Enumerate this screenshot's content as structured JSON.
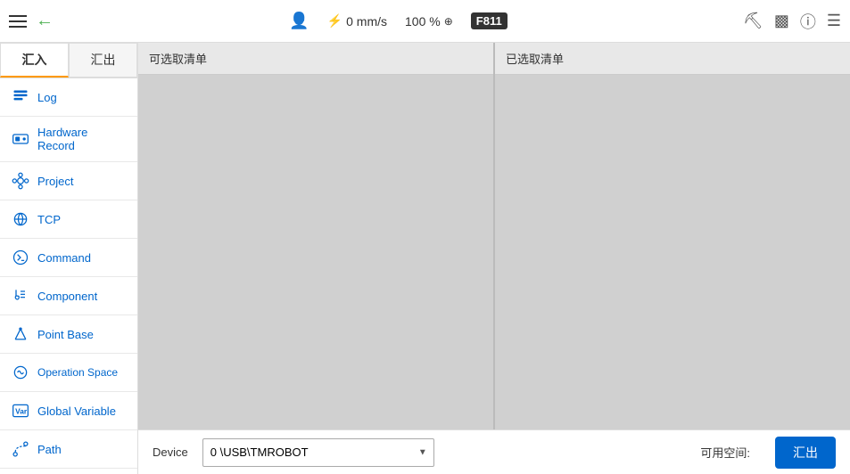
{
  "topbar": {
    "speed": "0 mm/s",
    "percent": "100 %",
    "f811": "F811",
    "icons": [
      "robot-icon",
      "monitor-icon",
      "info-icon",
      "menu-icon"
    ]
  },
  "sidebar": {
    "tab_import": "汇入",
    "tab_export": "汇出",
    "items": [
      {
        "id": "log",
        "label": "Log",
        "icon": "log"
      },
      {
        "id": "hardware-record",
        "label": "Hardware Record",
        "icon": "hardware"
      },
      {
        "id": "project",
        "label": "Project",
        "icon": "project"
      },
      {
        "id": "tcp",
        "label": "TCP",
        "icon": "tcp"
      },
      {
        "id": "command",
        "label": "Command",
        "icon": "command"
      },
      {
        "id": "component",
        "label": "Component",
        "icon": "component"
      },
      {
        "id": "point-base",
        "label": "Point Base",
        "icon": "pointbase"
      },
      {
        "id": "operation-space",
        "label": "Operation Space",
        "icon": "operation"
      },
      {
        "id": "global-variable",
        "label": "Global Variable",
        "icon": "variable"
      },
      {
        "id": "path",
        "label": "Path",
        "icon": "path"
      }
    ]
  },
  "panels": {
    "available_list_label": "可选取清单",
    "selected_list_label": "已选取清单"
  },
  "bottom": {
    "device_label": "Device",
    "device_value": "0     \\USB\\TMROBOT",
    "space_label": "可用空间:",
    "export_button": "汇出"
  }
}
